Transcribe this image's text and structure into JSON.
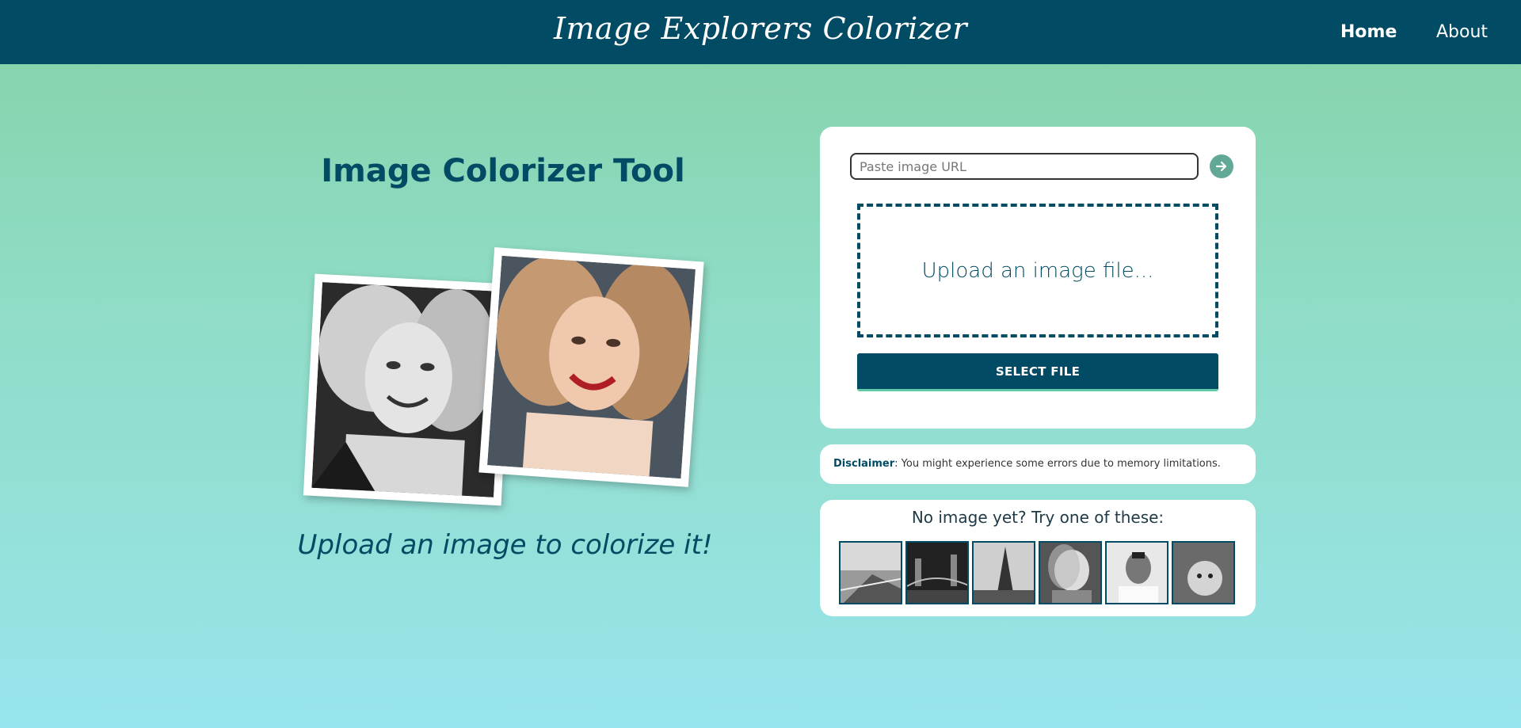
{
  "navbar": {
    "brand": "Image Explorers Colorizer",
    "links": [
      {
        "label": "Home",
        "active": true
      },
      {
        "label": "About",
        "active": false
      }
    ]
  },
  "hero": {
    "title": "Image Colorizer Tool",
    "tagline": "Upload an image to colorize it!"
  },
  "upload": {
    "url_placeholder": "Paste image URL",
    "url_value": "",
    "go_icon": "arrow-right-icon",
    "dropzone_text": "Upload an image file...",
    "select_button": "SELECT FILE"
  },
  "disclaimer": {
    "label": "Disclaimer",
    "text": ": You might experience some errors due to memory limitations."
  },
  "samples": {
    "title": "No image yet? Try one of these:",
    "thumbnails": [
      "boardwalk",
      "city-bridge",
      "eiffel-tower",
      "woman-portrait",
      "man-portrait",
      "puppy"
    ]
  },
  "colors": {
    "primary": "#024b64",
    "accent": "#62a897",
    "gradient_top": "#84d2a6",
    "gradient_bottom": "#97e5ee"
  }
}
